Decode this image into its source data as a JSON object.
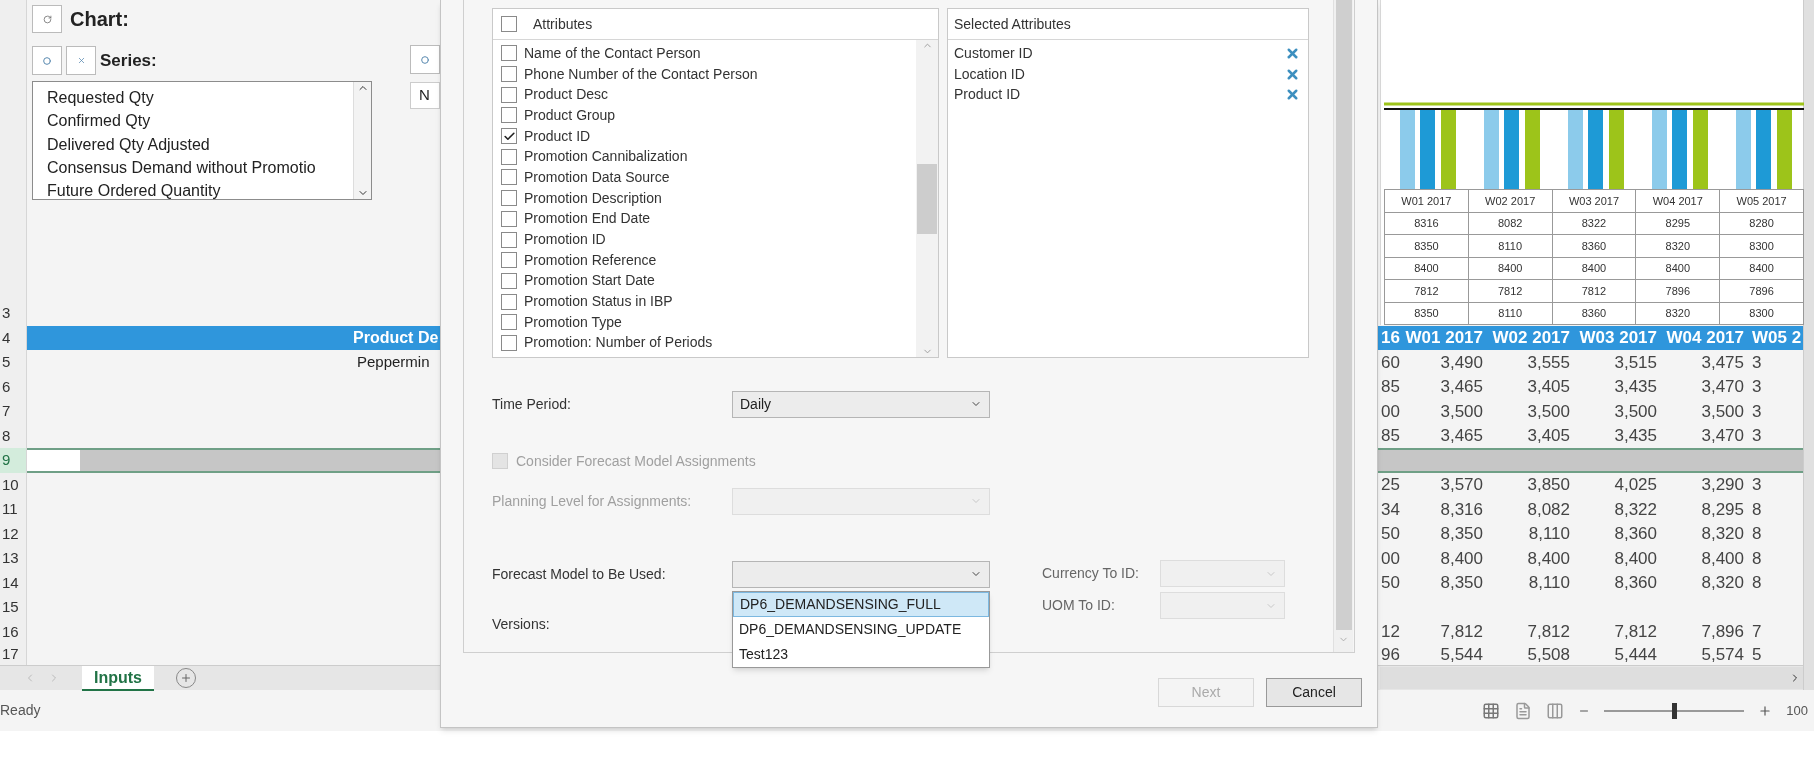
{
  "sheet": {
    "chart_panel": {
      "title": "Chart:",
      "series_label": "Series:",
      "series": [
        "Requested Qty",
        "Confirmed Qty",
        "Delivered Qty Adjusted",
        "Consensus Demand without Promotio",
        "Future Ordered Quantity"
      ],
      "side_field": "N"
    },
    "chart": {
      "table_header": [
        "W01 2017",
        "W02 2017",
        "W03 2017",
        "W04 2017",
        "W05 2017"
      ],
      "table_rows": [
        [
          "8316",
          "8082",
          "8322",
          "8295",
          "8280"
        ],
        [
          "8350",
          "8110",
          "8360",
          "8320",
          "8300"
        ],
        [
          "8400",
          "8400",
          "8400",
          "8400",
          "8400"
        ],
        [
          "7812",
          "7812",
          "7812",
          "7896",
          "7896"
        ],
        [
          "8350",
          "8110",
          "8360",
          "8320",
          "8300"
        ]
      ]
    },
    "rows": [
      {
        "number": "3",
        "kind": "empty",
        "selected": false
      },
      {
        "number": "4",
        "kind": "header",
        "selected": false,
        "left": "Product De",
        "cells": [
          "16",
          "W01 2017",
          "W02 2017",
          "W03 2017",
          "W04 2017",
          "W05 2"
        ]
      },
      {
        "number": "5",
        "kind": "data",
        "selected": false,
        "left": "Peppermin",
        "cells": [
          "60",
          "3,490",
          "3,555",
          "3,515",
          "3,475",
          "3"
        ]
      },
      {
        "number": "6",
        "kind": "data",
        "selected": false,
        "cells": [
          "85",
          "3,465",
          "3,405",
          "3,435",
          "3,470",
          "3"
        ]
      },
      {
        "number": "7",
        "kind": "data",
        "selected": false,
        "cells": [
          "00",
          "3,500",
          "3,500",
          "3,500",
          "3,500",
          "3"
        ]
      },
      {
        "number": "8",
        "kind": "data",
        "selected": false,
        "cells": [
          "85",
          "3,465",
          "3,405",
          "3,435",
          "3,470",
          "3"
        ]
      },
      {
        "number": "9",
        "kind": "separator",
        "selected": true
      },
      {
        "number": "10",
        "kind": "data",
        "selected": false,
        "cells": [
          "25",
          "3,570",
          "3,850",
          "4,025",
          "3,290",
          "3"
        ]
      },
      {
        "number": "11",
        "kind": "data",
        "selected": false,
        "cells": [
          "34",
          "8,316",
          "8,082",
          "8,322",
          "8,295",
          "8"
        ]
      },
      {
        "number": "12",
        "kind": "data",
        "selected": false,
        "cells": [
          "50",
          "8,350",
          "8,110",
          "8,360",
          "8,320",
          "8"
        ]
      },
      {
        "number": "13",
        "kind": "data",
        "selected": false,
        "cells": [
          "00",
          "8,400",
          "8,400",
          "8,400",
          "8,400",
          "8"
        ]
      },
      {
        "number": "14",
        "kind": "data",
        "selected": false,
        "cells": [
          "50",
          "8,350",
          "8,110",
          "8,360",
          "8,320",
          "8"
        ]
      },
      {
        "number": "15",
        "kind": "empty",
        "selected": false
      },
      {
        "number": "16",
        "kind": "data",
        "selected": false,
        "cells": [
          "12",
          "7,812",
          "7,812",
          "7,812",
          "7,896",
          "7"
        ]
      },
      {
        "number": "17",
        "kind": "data",
        "selected": false,
        "cells": [
          "96",
          "5,544",
          "5,508",
          "5,444",
          "5,574",
          "5"
        ]
      }
    ],
    "sheet_tabs": [
      {
        "label": "Inputs",
        "selected": true
      }
    ],
    "status": "Ready",
    "zoom_slider": {
      "level": 0.5
    },
    "zoom_level": "100"
  },
  "dialog": {
    "attributes": {
      "header": "Attributes",
      "all_checked": false,
      "items": [
        {
          "label": "Name of the Contact Person",
          "checked": false
        },
        {
          "label": "Phone Number of the Contact Person",
          "checked": false
        },
        {
          "label": "Product Desc",
          "checked": false
        },
        {
          "label": "Product Group",
          "checked": false
        },
        {
          "label": "Product ID",
          "checked": true
        },
        {
          "label": "Promotion Cannibalization",
          "checked": false
        },
        {
          "label": "Promotion Data Source",
          "checked": false
        },
        {
          "label": "Promotion Description",
          "checked": false
        },
        {
          "label": "Promotion End Date",
          "checked": false
        },
        {
          "label": "Promotion ID",
          "checked": false
        },
        {
          "label": "Promotion Reference",
          "checked": false
        },
        {
          "label": "Promotion Start Date",
          "checked": false
        },
        {
          "label": "Promotion Status in IBP",
          "checked": false
        },
        {
          "label": "Promotion Type",
          "checked": false
        },
        {
          "label": "Promotion: Number of Periods",
          "checked": false
        }
      ]
    },
    "selected_attributes": {
      "header": "Selected Attributes",
      "items": [
        "Customer ID",
        "Location ID",
        "Product ID"
      ]
    },
    "fields": [
      {
        "kind": "select",
        "label": "Time Period:",
        "value": "Daily",
        "disabled": false
      },
      {
        "kind": "checkbox",
        "label": "Consider Forecast Model Assignments",
        "checked": false,
        "disabled": true
      },
      {
        "kind": "select",
        "label": "Planning Level for Assignments:",
        "disabled": true
      }
    ],
    "forecast_model": {
      "label": "Forecast Model to Be Used:",
      "disabled": false,
      "expanded": true,
      "options": [
        {
          "label": "DP6_DEMANDSENSING_FULL",
          "selected": true
        },
        {
          "label": "DP6_DEMANDSENSING_UPDATE",
          "selected": false
        },
        {
          "label": "Test123",
          "selected": false
        }
      ]
    },
    "versions_label": "Versions:",
    "side_fields": [
      {
        "label": "Currency To ID:",
        "disabled": true
      },
      {
        "label": "UOM To ID:",
        "disabled": true
      }
    ],
    "buttons": [
      {
        "label": "Next",
        "disabled": true
      },
      {
        "label": "Cancel",
        "disabled": false
      }
    ]
  }
}
